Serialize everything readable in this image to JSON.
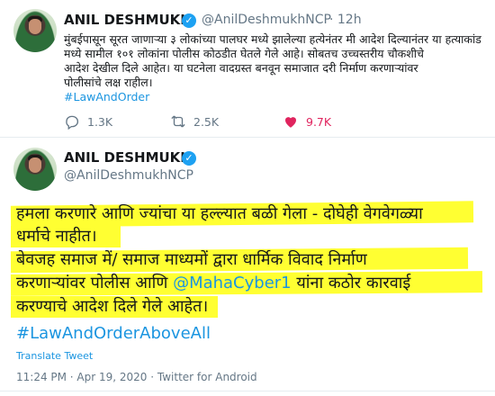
{
  "tweet1": {
    "name": "ANIL DESHMUKH",
    "handle": "@AnilDeshmukhNCP",
    "time": "· 12h",
    "lines": [
      "मुंबईपासून सूरत जाणाऱ्या ३ लोकांच्या पालघर मध्ये झालेल्या हत्येनंतर मी आदेश दिल्यानंतर या हत्याकांड",
      "मध्ये सामील १०१ लोकांना पोलीस कोठडीत घेतले गेले आहे। सोबतच उच्चस्तरीय चौकशीचे",
      "आदेश देखील दिले आहेत। या घटनेला वादग्रस्त बनवून समाजात दरी निर्माण करणाऱ्यांवर",
      "पोलीसांचे लक्ष राहील।"
    ],
    "hashtag": "#LawAndOrder",
    "replies": "1.3K",
    "retweets": "2.5K",
    "likes": "9.7K"
  },
  "tweet2": {
    "name": "ANIL DESHMUKH",
    "handle": "@AnilDeshmukhNCP",
    "line1": "हमला करणारे आणि ज्यांचा या हल्ल्यात बळी गेला -  दोघेही वेगवेगळ्या",
    "line2": "धर्माचे नाहीत।",
    "line3": "बेवजह समाज में/ समाज माध्यमों द्वारा धार्मिक विवाद  निर्माण",
    "line4_pre": "करणाऱ्यांवर पोलीस आणि ",
    "line4_mention": "@MahaCyber1",
    "line4_post": " यांना कठोर कारवाई",
    "line5": "करण्याचे आदेश दिले गेले आहेत।",
    "hashtag": "#LawAndOrderAboveAll",
    "translate": "Translate Tweet",
    "meta": "11:24 PM · Apr 19, 2020 · Twitter for Android"
  },
  "colors": {
    "accent": "#1da1f2",
    "like": "#e0245e",
    "highlight": "#ffff32",
    "muted": "#657786"
  },
  "icons": [
    "reply-icon",
    "retweet-icon",
    "heart-icon",
    "verified-badge-icon"
  ]
}
